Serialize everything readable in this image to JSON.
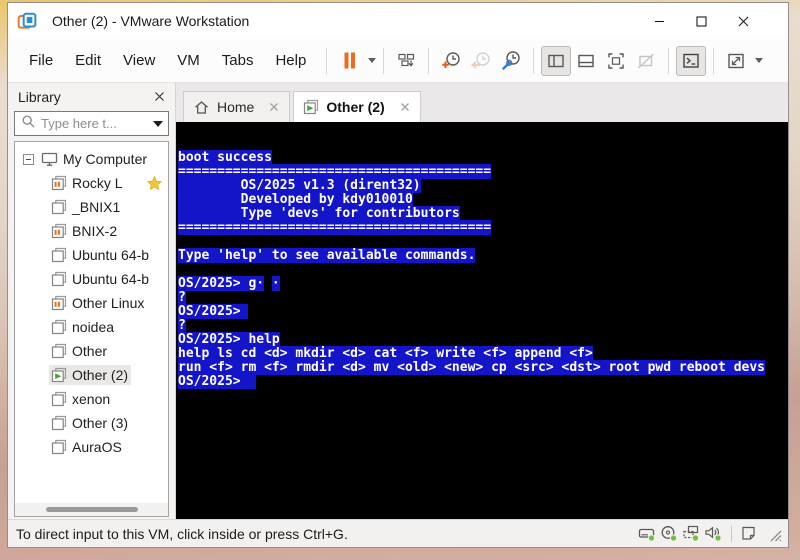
{
  "window": {
    "title": "Other (2) - VMware Workstation"
  },
  "menubar": {
    "items": [
      "File",
      "Edit",
      "View",
      "VM",
      "Tabs",
      "Help"
    ]
  },
  "toolbar": {
    "buttons": [
      {
        "name": "suspend-button",
        "icon": "pause-icon",
        "has_caret": true
      },
      {
        "name": "ctrl-alt-del-button",
        "icon": "ctrl-alt-del-icon"
      },
      {
        "name": "take-snapshot-button",
        "icon": "snapshot-take-icon"
      },
      {
        "name": "revert-snapshot-button",
        "icon": "snapshot-revert-icon",
        "disabled": true
      },
      {
        "name": "snapshot-manager-button",
        "icon": "snapshot-manager-icon"
      },
      {
        "name": "show-library-button",
        "icon": "panel-left-icon",
        "pressed": true
      },
      {
        "name": "show-thumbnails-button",
        "icon": "panel-bottom-icon"
      },
      {
        "name": "fullscreen-button",
        "icon": "fullscreen-icon"
      },
      {
        "name": "unity-button",
        "icon": "unity-icon",
        "disabled": true
      },
      {
        "name": "console-view-button",
        "icon": "console-icon",
        "pressed": true
      },
      {
        "name": "stretch-button",
        "icon": "stretch-icon",
        "has_caret": true
      }
    ]
  },
  "library": {
    "title": "Library",
    "search_placeholder": "Type here t...",
    "items": [
      {
        "label": "My Computer",
        "type": "computer"
      },
      {
        "label": "Rocky L",
        "state": "paused",
        "favorite": true
      },
      {
        "label": "_BNIX1",
        "state": "off"
      },
      {
        "label": "BNIX-2",
        "state": "paused"
      },
      {
        "label": "Ubuntu 64-b",
        "state": "off"
      },
      {
        "label": "Ubuntu 64-b",
        "state": "off"
      },
      {
        "label": "Other Linux",
        "state": "paused"
      },
      {
        "label": "noidea",
        "state": "off"
      },
      {
        "label": "Other",
        "state": "off"
      },
      {
        "label": "Other (2)",
        "state": "running",
        "selected": true
      },
      {
        "label": "xenon",
        "state": "off"
      },
      {
        "label": "Other (3)",
        "state": "off"
      },
      {
        "label": "AuraOS",
        "state": "off"
      }
    ]
  },
  "tabs": [
    {
      "label": "Home",
      "icon": "home-icon",
      "active": false
    },
    {
      "label": "Other (2)",
      "icon": "vm-running-icon",
      "active": true
    }
  ],
  "console": {
    "colors": {
      "background": "#000000",
      "text": "#ffffff",
      "highlight": "#1414c8"
    },
    "lines": [
      [
        {
          "t": "boot success",
          "h": true
        }
      ],
      [
        {
          "t": "========================================",
          "h": true
        }
      ],
      [
        {
          "t": "        OS/2025 v1.3 (dirent32)",
          "h": true
        }
      ],
      [
        {
          "t": "        Developed by kdy010010",
          "h": true
        }
      ],
      [
        {
          "t": "        Type 'devs' for contributors",
          "h": true
        }
      ],
      [
        {
          "t": "========================================",
          "h": true
        }
      ],
      [],
      [
        {
          "t": "Type 'help' to see available commands.",
          "h": true
        }
      ],
      [],
      [
        {
          "t": "OS/2025> g·",
          "h": true
        },
        {
          "t": " ",
          "h": false
        },
        {
          "t": "·",
          "h": true
        }
      ],
      [
        {
          "t": "?",
          "h": true
        }
      ],
      [
        {
          "t": "OS/2025> ",
          "h": true
        }
      ],
      [
        {
          "t": "?",
          "h": true
        }
      ],
      [
        {
          "t": "OS/2025> help",
          "h": true
        }
      ],
      [
        {
          "t": "help ls cd <d> mkdir <d> cat <f> write <f> append <f>",
          "h": true
        }
      ],
      [
        {
          "t": "run <f> rm <f> rmdir <d> mv <old> <new> cp <src> <dst> root pwd reboot devs",
          "h": true
        }
      ],
      [
        {
          "t": "OS/2025>  ",
          "h": true
        }
      ]
    ]
  },
  "statusbar": {
    "message": "To direct input to this VM, click inside or press Ctrl+G.",
    "device_icons": [
      "hard-disk-icon",
      "cd-dvd-icon",
      "network-adapter-icon",
      "sound-icon",
      "message-log-icon"
    ]
  },
  "colors": {
    "accent_orange": "#ed6b21",
    "running_green": "#3faa34",
    "status_green": "#71bf44",
    "favorite_yellow": "#f6c62e"
  }
}
